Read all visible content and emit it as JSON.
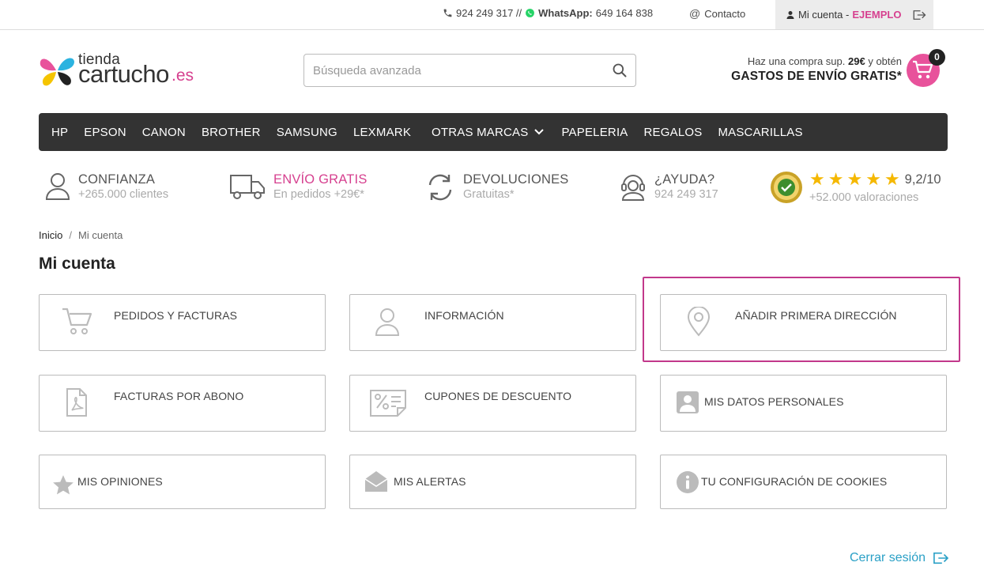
{
  "topbar": {
    "phone": "924 249 317 //",
    "whatsapp_label": "WhatsApp:",
    "whatsapp_number": "649 164 838",
    "contact": "Contacto",
    "account_label": "Mi cuenta -",
    "account_user": "EJEMPLO"
  },
  "logo": {
    "top": "tienda",
    "main": "cartucho",
    "suffix": ".es"
  },
  "search": {
    "placeholder": "Búsqueda avanzada"
  },
  "promo": {
    "line1_pre": "Haz una compra sup.",
    "line1_amount": "29€",
    "line1_post": "y obtén",
    "line2": "GASTOS DE ENVÍO GRATIS*"
  },
  "cart": {
    "count": "0"
  },
  "nav": [
    "HP",
    "EPSON",
    "CANON",
    "BROTHER",
    "SAMSUNG",
    "LEXMARK",
    "OTRAS MARCAS",
    "PAPELERIA",
    "REGALOS",
    "MASCARILLAS"
  ],
  "features": [
    {
      "title": "CONFIANZA",
      "sub": "+265.000 clientes",
      "icon": "user-icon"
    },
    {
      "title": "ENVÍO GRATIS",
      "sub": "En pedidos +29€*",
      "icon": "truck-icon"
    },
    {
      "title": "DEVOLUCIONES",
      "sub": "Gratuitas*",
      "icon": "refresh-icon"
    },
    {
      "title": "¿AYUDA?",
      "sub": "924 249 317",
      "icon": "headset-icon"
    }
  ],
  "rating": {
    "score": "9,2/10",
    "count": "+52.000 valoraciones",
    "stars": 5
  },
  "breadcrumb": {
    "home": "Inicio",
    "sep": "/",
    "current": "Mi cuenta"
  },
  "page_title": "Mi cuenta",
  "tiles": [
    {
      "label": "PEDIDOS Y FACTURAS",
      "icon": "cart-icon"
    },
    {
      "label": "INFORMACIÓN",
      "icon": "user-icon"
    },
    {
      "label": "AÑADIR PRIMERA DIRECCIÓN",
      "icon": "location-pin-icon"
    },
    {
      "label": "FACTURAS POR ABONO",
      "icon": "pdf-file-icon"
    },
    {
      "label": "CUPONES DE DESCUENTO",
      "icon": "coupon-icon"
    },
    {
      "label": "MIS DATOS PERSONALES",
      "icon": "id-card-icon"
    },
    {
      "label": "MIS OPINIONES",
      "icon": "star-icon"
    },
    {
      "label": "MIS ALERTAS",
      "icon": "envelope-icon"
    },
    {
      "label": "TU CONFIGURACIÓN DE COOKIES",
      "icon": "info-icon"
    }
  ],
  "logout": "Cerrar sesión",
  "colors": {
    "brand_pink": "#d6408f",
    "nav_bg": "#333333",
    "link_blue": "#2aa0c6",
    "highlight": "#c2388b"
  }
}
